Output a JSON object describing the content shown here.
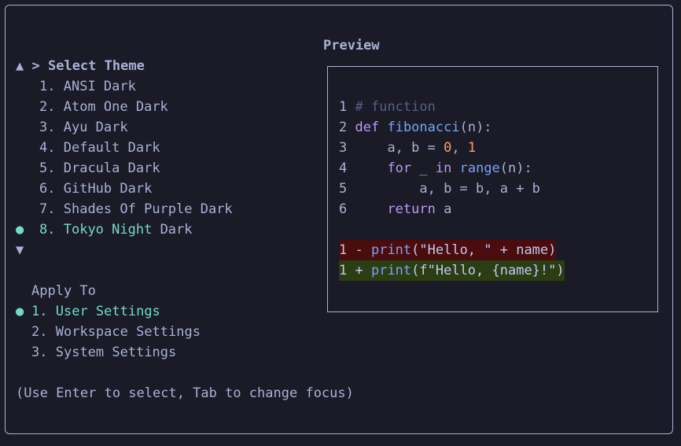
{
  "theme_dialog": {
    "title_prefix": ">",
    "title": "Select Theme",
    "scroll_up": "▲",
    "scroll_down": "▼",
    "selected_marker": "●",
    "themes": [
      {
        "num": "1.",
        "name": "ANSI Dark"
      },
      {
        "num": "2.",
        "name": "Atom One Dark"
      },
      {
        "num": "3.",
        "name": "Ayu Dark"
      },
      {
        "num": "4.",
        "name": "Default Dark"
      },
      {
        "num": "5.",
        "name": "Dracula Dark"
      },
      {
        "num": "6.",
        "name": "GitHub Dark"
      },
      {
        "num": "7.",
        "name": "Shades Of Purple Dark"
      },
      {
        "num": "8.",
        "name_a": "Tokyo Night",
        "name_b": " Dark"
      }
    ],
    "apply_to": {
      "label": "Apply To",
      "options": [
        {
          "num": "1.",
          "name": "User Settings"
        },
        {
          "num": "2.",
          "name": "Workspace Settings"
        },
        {
          "num": "3.",
          "name": "System Settings"
        }
      ]
    },
    "hint": "(Use Enter to select, Tab to change focus)"
  },
  "preview": {
    "title": "Preview",
    "code": {
      "l1": {
        "n": "1",
        "comment": "# function"
      },
      "l2": {
        "n": "2",
        "kw": "def",
        "fn": "fibonacci",
        "rest": "(n):"
      },
      "l3": {
        "n": "3",
        "a": "a, b = ",
        "v0": "0",
        "sep": ", ",
        "v1": "1"
      },
      "l4": {
        "n": "4",
        "kw_for": "for",
        "mid": " _ ",
        "kw_in": "in",
        "sp": " ",
        "fn": "range",
        "rest": "(n):"
      },
      "l5": {
        "n": "5",
        "text": "a, b = b, a + b"
      },
      "l6": {
        "n": "6",
        "kw": "return",
        "rest": " a"
      }
    },
    "diff_del": {
      "n": "1",
      "sign": " - ",
      "fn": "print",
      "rest": "(\"Hello, \" + name)"
    },
    "diff_add": {
      "n": "1",
      "sign": " + ",
      "fn": "print",
      "rest": "(f\"Hello, {name}!\")"
    }
  },
  "colors": {
    "background": "#1a1b26",
    "border": "#a9b1d6",
    "selected": "#73daca",
    "keyword": "#bb9af7",
    "function": "#7aa2f7",
    "number": "#ff9e64",
    "comment": "#565f89",
    "diff_del_bg": "#4a0c0c",
    "diff_add_bg": "#2b3d12"
  }
}
